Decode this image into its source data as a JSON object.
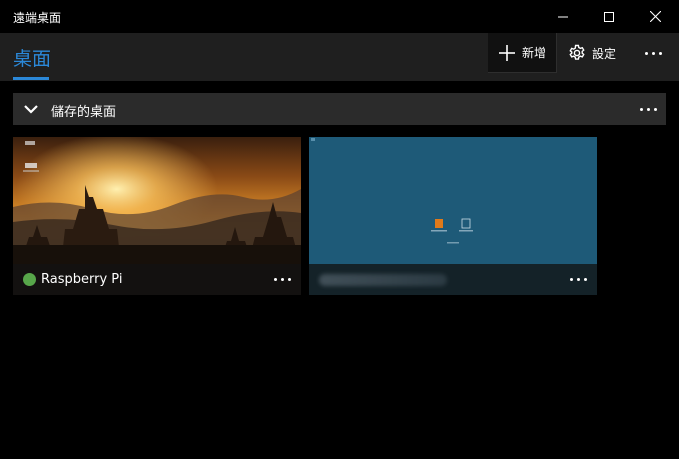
{
  "window": {
    "title": "遠端桌面",
    "minimize_icon": "minimize-icon",
    "maximize_icon": "maximize-icon",
    "close_icon": "close-icon"
  },
  "command_bar": {
    "pivot_label": "桌面",
    "add_label": "新增",
    "add_icon": "plus-icon",
    "settings_label": "設定",
    "settings_icon": "gear-icon",
    "more_icon": "more-icon"
  },
  "group": {
    "label": "儲存的桌面",
    "chevron_icon": "chevron-down-icon",
    "more_icon": "more-icon"
  },
  "desktops": [
    {
      "name": "Raspberry Pi",
      "status": "connected",
      "status_color": "#57a64a",
      "thumbnail": "sunset-temple-wallpaper"
    },
    {
      "name": "",
      "name_obscured": true,
      "thumbnail": "blue-desktop-wallpaper"
    }
  ],
  "colors": {
    "accent": "#2b88d8",
    "background": "#000000",
    "command_bar": "#1f1f1f",
    "group_header": "#2b2b2b",
    "tile2_background": "#1e5a78"
  }
}
